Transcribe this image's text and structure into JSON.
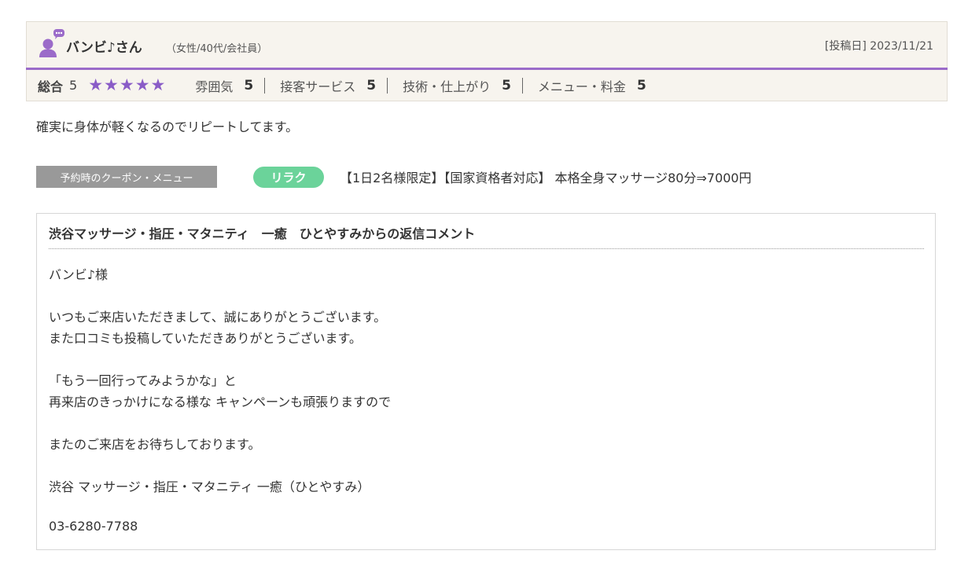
{
  "review": {
    "reviewer": {
      "name": "バンビ♪さん",
      "attributes": "（女性/40代/会社員）"
    },
    "post_date": "[投稿日] 2023/11/21",
    "overall_label": "総合",
    "overall_score": "5",
    "stars": 5,
    "categories": [
      {
        "label": "雰囲気",
        "score": "5"
      },
      {
        "label": "接客サービス",
        "score": "5"
      },
      {
        "label": "技術・仕上がり",
        "score": "5"
      },
      {
        "label": "メニュー・料金",
        "score": "5"
      }
    ],
    "body": "確実に身体が軽くなるのでリピートしてます。",
    "coupon": {
      "label": "予約時のクーポン・メニュー",
      "tag": "リラク",
      "text": "【1日2名様限定】【国家資格者対応】 本格全身マッサージ80分⇒7000円"
    }
  },
  "reply": {
    "title": "渋谷マッサージ・指圧・マタニティ　一癒　ひとやすみからの返信コメント",
    "lines": [
      "バンビ♪様",
      "いつもご来店いただきまして、誠にありがとうございます。",
      "また口コミも投稿していただきありがとうございます。",
      "「もう一回行ってみようかな」と",
      "再来店のきっかけになる様な キャンペーンも頑張りますので",
      "またのご来店をお待ちしております。",
      "渋谷 マッサージ・指圧・マタニティ 一癒（ひとやすみ）",
      "03-6280-7788"
    ]
  },
  "colors": {
    "accent_purple": "#9b6bc9",
    "star_purple": "#8a5cc7",
    "header_bg": "#f7f4ee",
    "coupon_tag_green": "#6bd39a",
    "coupon_label_gray": "#999999"
  },
  "icons": {
    "avatar": "user-speech-bubble-icon",
    "star": "star-icon"
  }
}
